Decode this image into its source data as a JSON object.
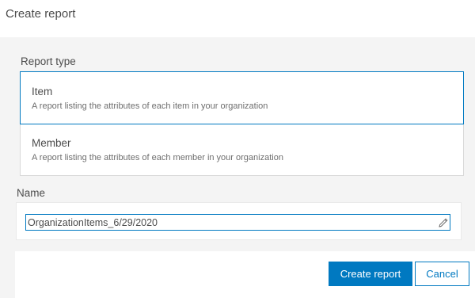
{
  "dialog": {
    "title": "Create report"
  },
  "report_type": {
    "label": "Report type",
    "options": [
      {
        "title": "Item",
        "description": "A report listing the attributes of each item in your organization",
        "selected": true
      },
      {
        "title": "Member",
        "description": "A report listing the attributes of each member in your organization",
        "selected": false
      }
    ]
  },
  "name": {
    "label": "Name",
    "value": "OrganizationItems_6/29/2020",
    "edit_icon": "pencil-icon"
  },
  "footer": {
    "create_label": "Create report",
    "cancel_label": "Cancel"
  },
  "colors": {
    "accent": "#0079c1",
    "text": "#4c4c4c",
    "background": "#f4f4f4"
  }
}
